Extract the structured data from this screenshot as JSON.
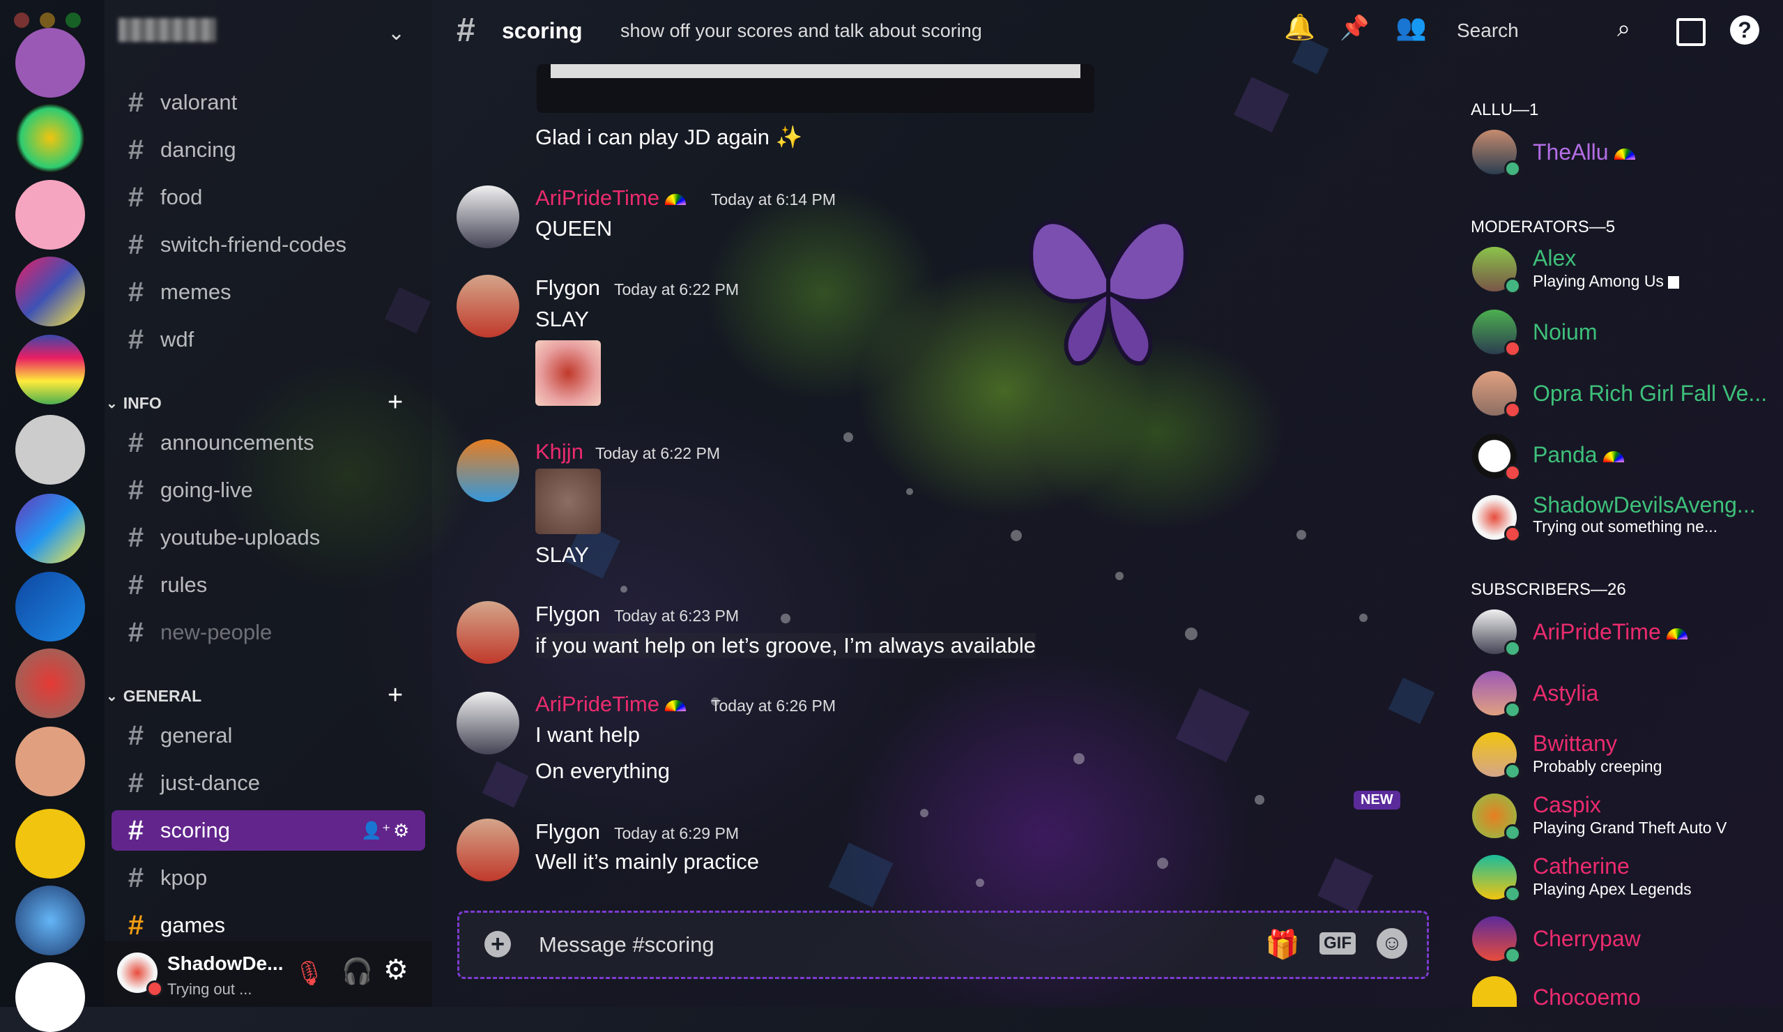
{
  "window_controls": {
    "close_color": "#ff5f57",
    "minimize_color": "#febc2e",
    "maximize_color": "#28c840"
  },
  "servers": [
    {
      "icon": "server-icon-1",
      "color": "#9b59b6"
    },
    {
      "icon": "server-icon-2",
      "color": "#2ecc71"
    },
    {
      "icon": "server-icon-3",
      "color": "#f6a5c0"
    },
    {
      "icon": "server-icon-just-dance",
      "color": "#3f51b5"
    },
    {
      "icon": "server-icon-5",
      "color": "#e91e63"
    },
    {
      "icon": "server-icon-6",
      "color": "#cccccc"
    },
    {
      "icon": "server-icon-7",
      "color": "#673ab7"
    },
    {
      "icon": "server-icon-8",
      "color": "#1e88e5"
    },
    {
      "icon": "server-icon-9",
      "color": "#c0392b"
    },
    {
      "icon": "server-icon-10",
      "color": "#e0a080"
    },
    {
      "icon": "server-icon-11",
      "color": "#f1c40f"
    },
    {
      "icon": "server-icon-12",
      "color": "#3498db"
    },
    {
      "icon": "server-icon-13",
      "color": "#ffffff"
    }
  ],
  "sidebar": {
    "channels_top": [
      "valorant",
      "dancing",
      "food",
      "switch-friend-codes",
      "memes",
      "wdf"
    ],
    "category_info": "INFO",
    "channels_info": [
      "announcements",
      "going-live",
      "youtube-uploads",
      "rules",
      "new-people"
    ],
    "category_general": "GENERAL",
    "channels_general": [
      "general",
      "just-dance",
      "scoring",
      "kpop",
      "games"
    ],
    "hash": "#"
  },
  "user_panel": {
    "name": "ShadowDe...",
    "status": "Trying out ..."
  },
  "topbar": {
    "channel_name": "scoring",
    "topic": "show off your scores and talk about scoring",
    "search_placeholder": "Search"
  },
  "messages": [
    {
      "text": "Glad i can play JD again ✨"
    },
    {
      "author": "AriPrideTime",
      "time": "Today at 6:14 PM",
      "lines": [
        "QUEEN"
      ]
    },
    {
      "author": "Flygon",
      "time": "Today at 6:22 PM",
      "lines": [
        "SLAY"
      ]
    },
    {
      "author": "Khjjn",
      "time": "Today at 6:22 PM",
      "lines": [
        "SLAY"
      ]
    },
    {
      "author": "Flygon",
      "time": "Today at 6:23 PM",
      "lines": [
        "if you want help on let’s groove, I’m always available"
      ]
    },
    {
      "author": "AriPrideTime",
      "time": "Today at 6:26 PM",
      "lines": [
        "I want help",
        "On everything"
      ]
    },
    {
      "author": "Flygon",
      "time": "Today at 6:29 PM",
      "lines": [
        "Well it’s mainly practice"
      ]
    }
  ],
  "new_badge": "NEW",
  "composer": {
    "placeholder": "Message #scoring",
    "gif_label": "GIF"
  },
  "members": {
    "allu_header": "ALLU—1",
    "allu": [
      {
        "name": "TheAllu",
        "color": "#b46ee6"
      }
    ],
    "moderators_header": "MODERATORS—5",
    "moderators": [
      {
        "name": "Alex",
        "status": "Playing Among Us",
        "color": "#3ec07a"
      },
      {
        "name": "Noium",
        "status": "",
        "color": "#3ec07a"
      },
      {
        "name": "Opra Rich Girl Fall Ve...",
        "status": "",
        "color": "#3ec07a"
      },
      {
        "name": "Panda",
        "status": "",
        "color": "#3ec07a"
      },
      {
        "name": "ShadowDevilsAveng...",
        "status": "Trying out something ne...",
        "color": "#3ec07a"
      }
    ],
    "subscribers_header": "SUBSCRIBERS—26",
    "subscribers": [
      {
        "name": "AriPrideTime",
        "status": "",
        "color": "#ec2b6e"
      },
      {
        "name": "Astylia",
        "status": "",
        "color": "#ec2b6e"
      },
      {
        "name": "Bwittany",
        "status": "Probably creeping",
        "color": "#ec2b6e"
      },
      {
        "name": "Caspix",
        "status": "Playing Grand Theft Auto V",
        "color": "#ec2b6e"
      },
      {
        "name": "Catherine",
        "status": "Playing Apex Legends",
        "color": "#ec2b6e"
      },
      {
        "name": "Cherrypaw",
        "status": "",
        "color": "#ec2b6e"
      },
      {
        "name": "Chocoemo",
        "status": "",
        "color": "#ec2b6e"
      }
    ]
  }
}
